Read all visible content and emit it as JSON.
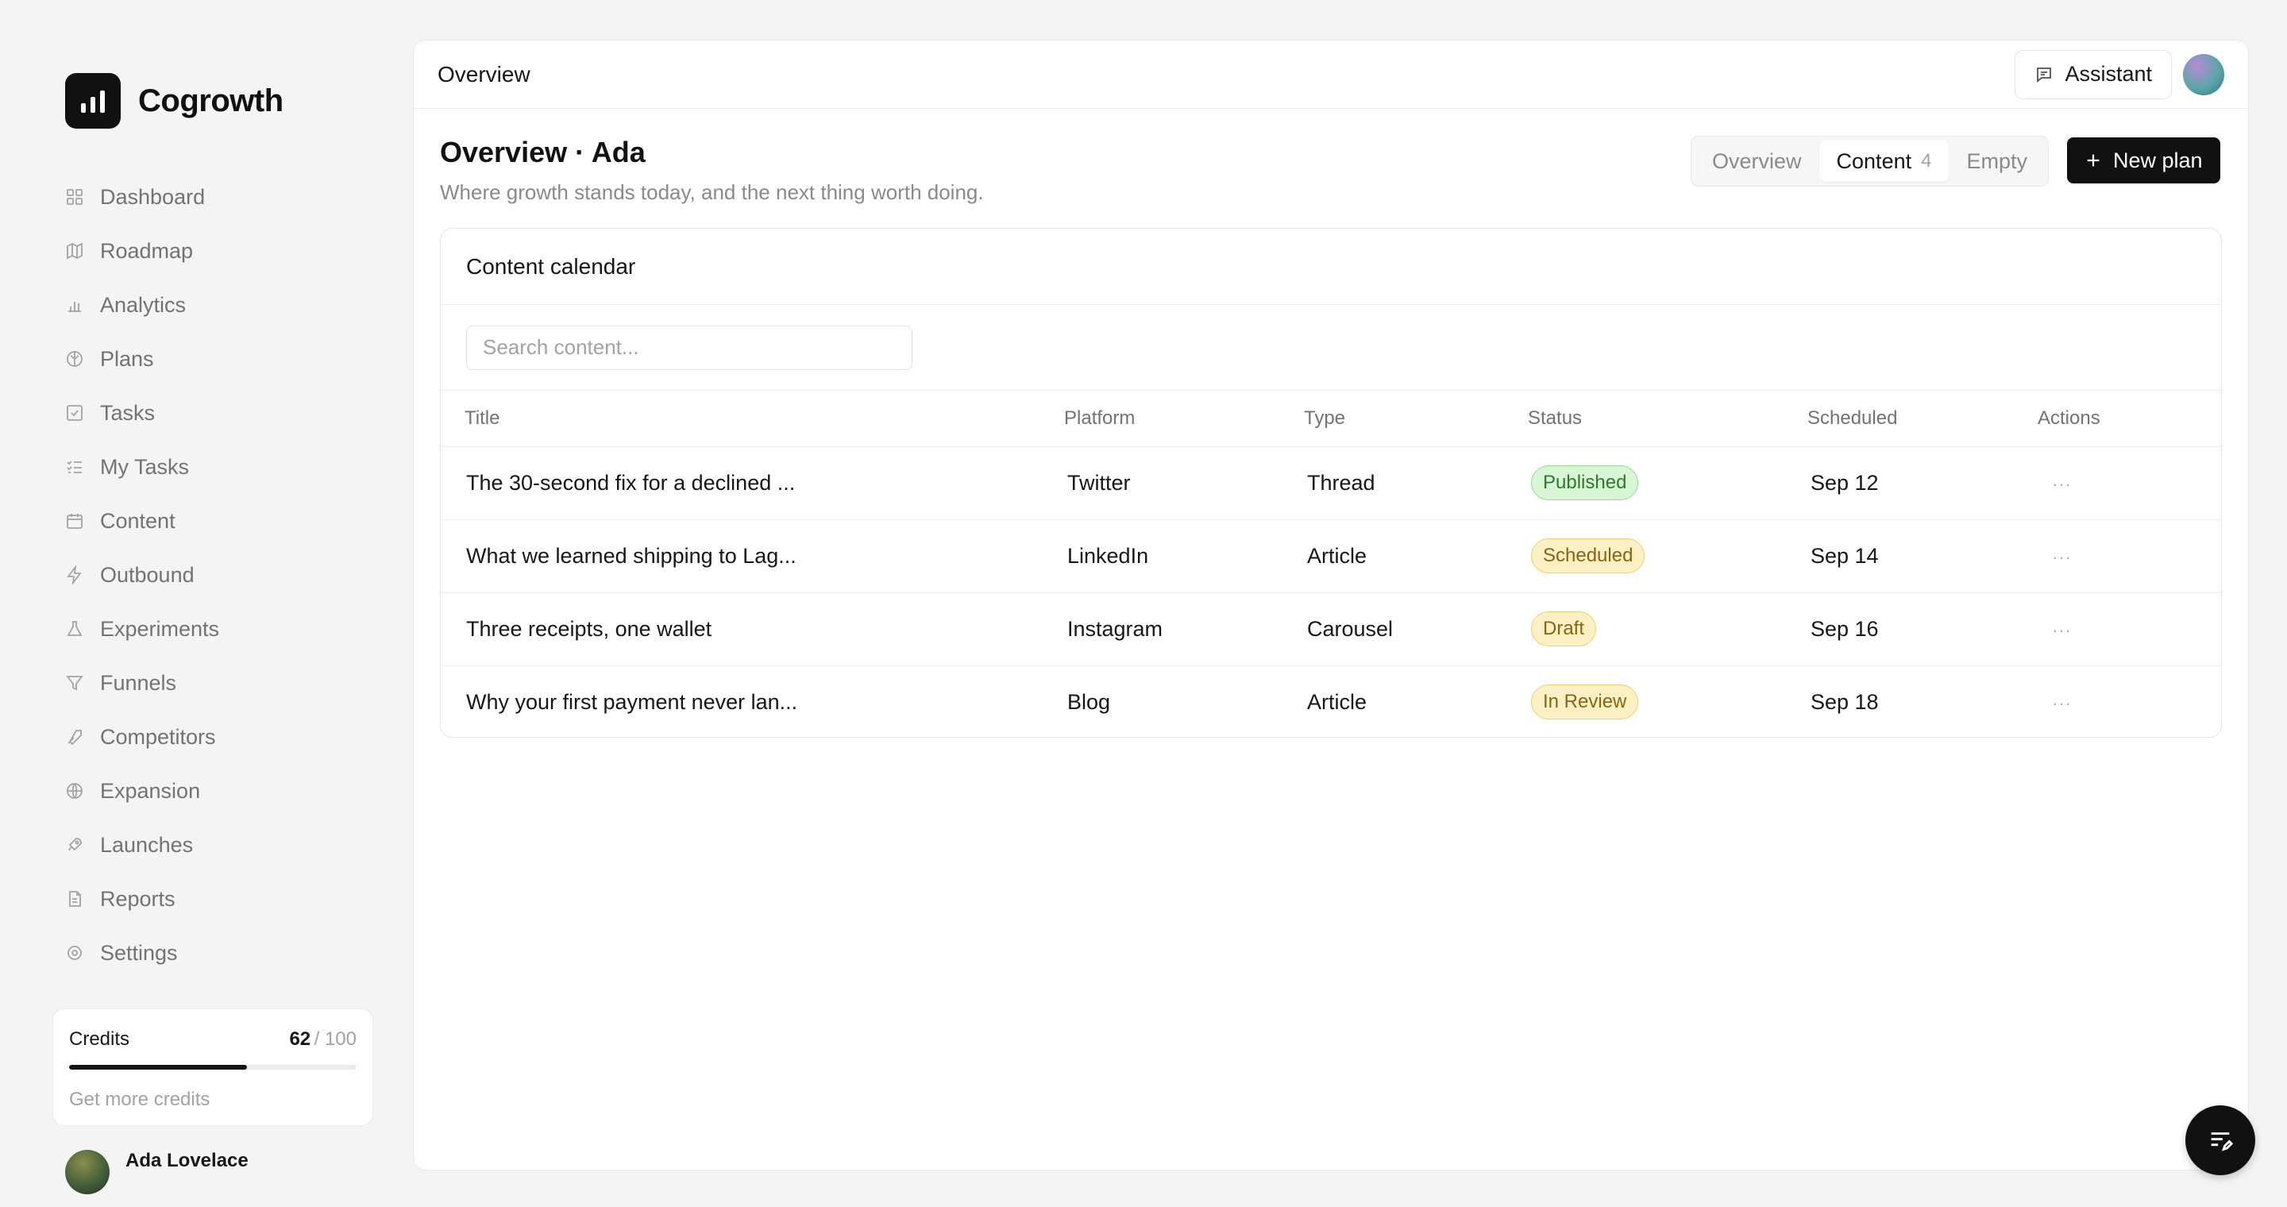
{
  "brand": {
    "name": "Cogrowth"
  },
  "sidebar": {
    "items": [
      {
        "label": "Dashboard",
        "icon": "grid-icon"
      },
      {
        "label": "Roadmap",
        "icon": "map-icon"
      },
      {
        "label": "Analytics",
        "icon": "bar-chart-icon"
      },
      {
        "label": "Plans",
        "icon": "brain-icon"
      },
      {
        "label": "Tasks",
        "icon": "check-square-icon"
      },
      {
        "label": "My Tasks",
        "icon": "list-checks-icon"
      },
      {
        "label": "Content",
        "icon": "calendar-icon"
      },
      {
        "label": "Outbound",
        "icon": "zap-icon"
      },
      {
        "label": "Experiments",
        "icon": "flask-icon"
      },
      {
        "label": "Funnels",
        "icon": "filter-icon"
      },
      {
        "label": "Competitors",
        "icon": "swords-icon"
      },
      {
        "label": "Expansion",
        "icon": "globe-icon"
      },
      {
        "label": "Launches",
        "icon": "rocket-icon"
      },
      {
        "label": "Reports",
        "icon": "file-icon"
      },
      {
        "label": "Settings",
        "icon": "gear-icon"
      }
    ]
  },
  "credits": {
    "title": "Credits",
    "used": "62",
    "total": "/ 100",
    "fraction": 0.62,
    "link": "Get more credits"
  },
  "user": {
    "name": "Ada Lovelace"
  },
  "topbar": {
    "title": "Overview",
    "assistant_label": "Assistant"
  },
  "page": {
    "title": "Overview · Ada",
    "subtitle": "Where growth stands today, and the next thing worth doing."
  },
  "tabs": [
    {
      "label": "Overview",
      "count": ""
    },
    {
      "label": "Content",
      "count": "4"
    },
    {
      "label": "Empty",
      "count": ""
    }
  ],
  "new_plan_label": "New plan",
  "calendar": {
    "title": "Content calendar",
    "search_placeholder": "Search content...",
    "columns": [
      "Title",
      "Platform",
      "Type",
      "Status",
      "Scheduled",
      "Actions"
    ],
    "rows": [
      {
        "title": "The 30-second fix for a declined ...",
        "platform": "Twitter",
        "type": "Thread",
        "status": "Published",
        "scheduled": "Sep 12",
        "actions": "···"
      },
      {
        "title": "What we learned shipping to Lag...",
        "platform": "LinkedIn",
        "type": "Article",
        "status": "Scheduled",
        "scheduled": "Sep 14",
        "actions": "···"
      },
      {
        "title": "Three receipts, one wallet",
        "platform": "Instagram",
        "type": "Carousel",
        "status": "Draft",
        "scheduled": "Sep 16",
        "actions": "···"
      },
      {
        "title": "Why your first payment never lan...",
        "platform": "Blog",
        "type": "Article",
        "status": "In Review",
        "scheduled": "Sep 18",
        "actions": "···"
      }
    ]
  },
  "colors": {
    "accent": "#111111",
    "published": "#d8f6d6",
    "pending": "#fdf0c4"
  }
}
